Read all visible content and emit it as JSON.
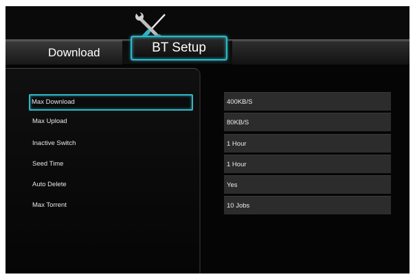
{
  "tabs": [
    {
      "label": "Download",
      "selected": false
    },
    {
      "label": "BT Setup",
      "selected": true
    }
  ],
  "settings": [
    {
      "label": "Max Download",
      "value": "400KB/S",
      "focused": true
    },
    {
      "label": "Max Upload",
      "value": "80KB/S",
      "focused": false
    },
    {
      "label": "Inactive Switch",
      "value": "1 Hour",
      "focused": false
    },
    {
      "label": "Seed Time",
      "value": "1 Hour",
      "focused": false
    },
    {
      "label": "Auto Delete",
      "value": "Yes",
      "focused": false
    },
    {
      "label": "Max Torrent",
      "value": "10 Jobs",
      "focused": false
    }
  ],
  "colors": {
    "accent": "#2fb7c7",
    "background": "#050505",
    "value_box": "#2c2c2c"
  },
  "icons": {
    "header": "tools-icon"
  }
}
